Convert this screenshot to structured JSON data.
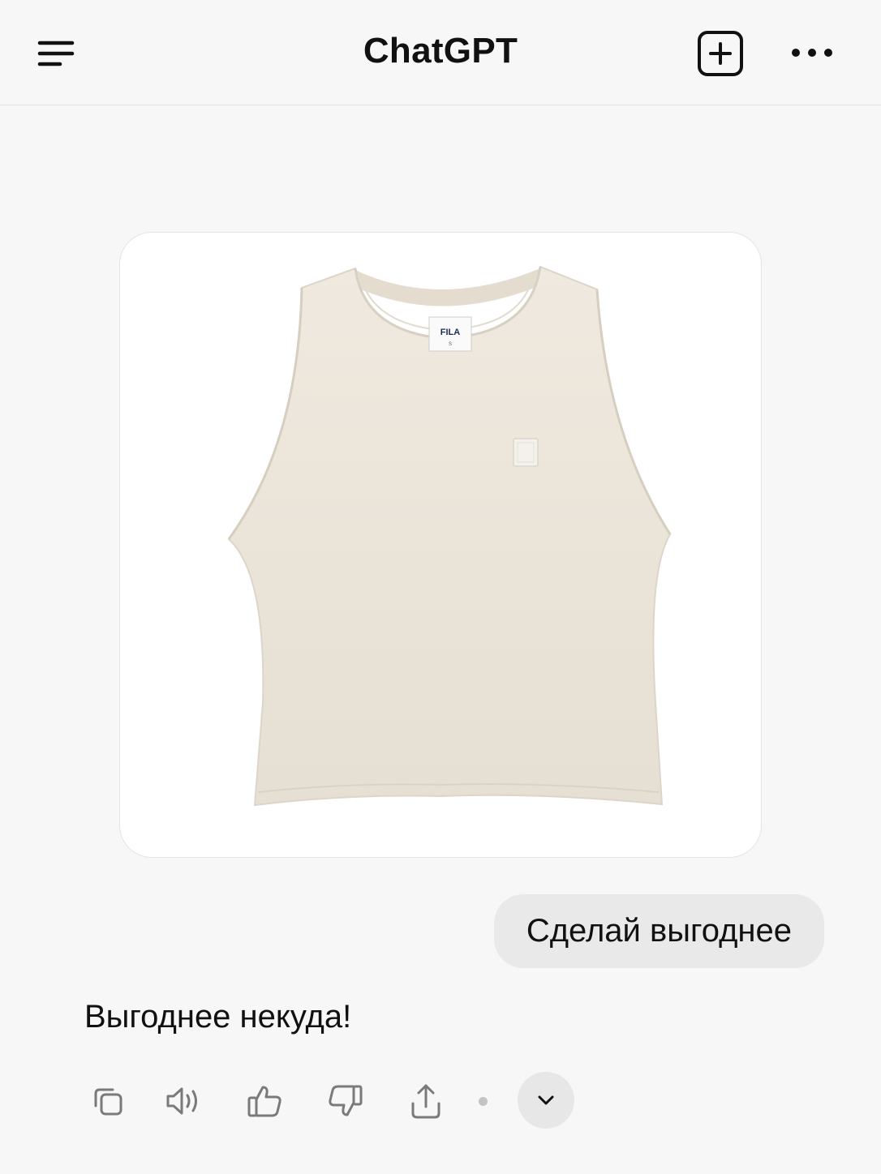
{
  "header": {
    "title": "ChatGPT",
    "icons": {
      "menu": "hamburger-menu-icon",
      "new_chat": "new-chat-plus-square-icon",
      "more": "ellipsis-icon"
    }
  },
  "conversation": {
    "image": {
      "description_icon": "product-photo",
      "label_brand": "FILA",
      "label_size": "S",
      "garment_color": "#ece6dc"
    },
    "user_message": "Сделай выгоднее",
    "assistant_message": "Выгоднее некуда!"
  },
  "actions": {
    "icons": [
      "copy-icon",
      "read-aloud-icon",
      "thumbs-up-icon",
      "thumbs-down-icon",
      "share-icon",
      "chevron-down-icon"
    ]
  },
  "colors": {
    "background": "#f7f7f7",
    "user_bubble": "#e9e9e9",
    "icon": "#7a7a7a"
  }
}
